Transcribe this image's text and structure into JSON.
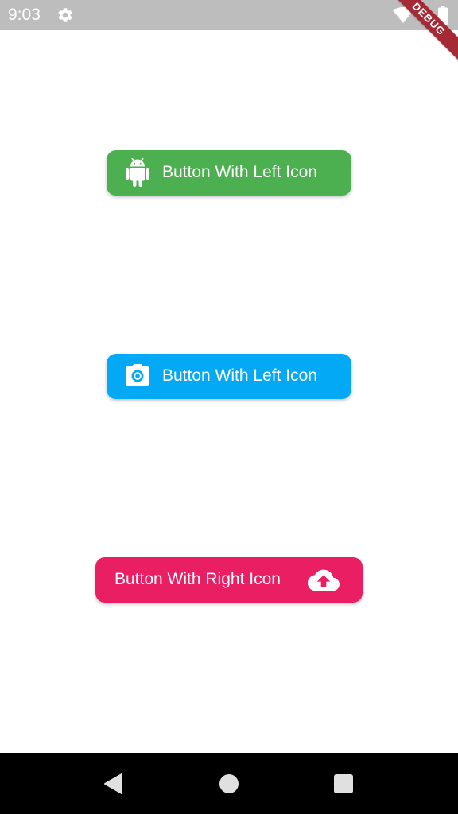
{
  "status_bar": {
    "time": "9:03",
    "settings_icon": "gear-icon",
    "wifi_icon": "wifi-icon",
    "battery_icon": "battery-icon",
    "background": "#bdbdbd"
  },
  "debug_banner": {
    "label": "DEBUG",
    "color": "#a52a36"
  },
  "buttons": [
    {
      "label": "Button With Left Icon",
      "icon": "android-icon",
      "icon_position": "left",
      "color": "#4caf50"
    },
    {
      "label": "Button With Left Icon",
      "icon": "camera-icon",
      "icon_position": "left",
      "color": "#03a9f4"
    },
    {
      "label": "Button With Right Icon",
      "icon": "cloud-upload-icon",
      "icon_position": "right",
      "color": "#e91e63"
    }
  ],
  "nav_bar": {
    "back_icon": "back-triangle-icon",
    "home_icon": "home-circle-icon",
    "recents_icon": "recents-square-icon"
  }
}
